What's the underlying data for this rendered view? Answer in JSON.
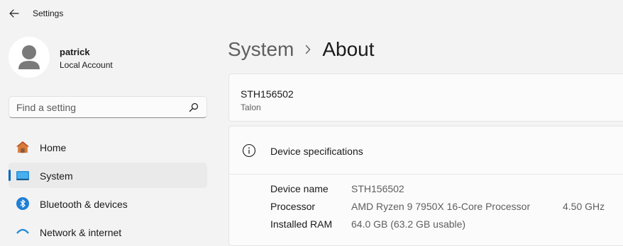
{
  "window": {
    "title": "Settings"
  },
  "profile": {
    "name": "patrick",
    "account_type": "Local Account"
  },
  "search": {
    "placeholder": "Find a setting"
  },
  "sidebar": {
    "items": [
      {
        "label": "Home",
        "icon": "home-icon"
      },
      {
        "label": "System",
        "icon": "system-icon",
        "selected": true
      },
      {
        "label": "Bluetooth & devices",
        "icon": "bluetooth-icon"
      },
      {
        "label": "Network & internet",
        "icon": "network-icon"
      }
    ]
  },
  "breadcrumb": {
    "parent": "System",
    "current": "About"
  },
  "device": {
    "name": "STH156502",
    "model": "Talon"
  },
  "specs": {
    "title": "Device specifications",
    "rows": [
      {
        "label": "Device name",
        "value": "STH156502",
        "extra": ""
      },
      {
        "label": "Processor",
        "value": "AMD Ryzen 9 7950X 16-Core Processor",
        "extra": "4.50 GHz"
      },
      {
        "label": "Installed RAM",
        "value": "64.0 GB (63.2 GB usable)",
        "extra": ""
      }
    ]
  },
  "colors": {
    "accent": "#0067c0",
    "background": "#f3f3f3",
    "card": "#fbfbfb"
  }
}
